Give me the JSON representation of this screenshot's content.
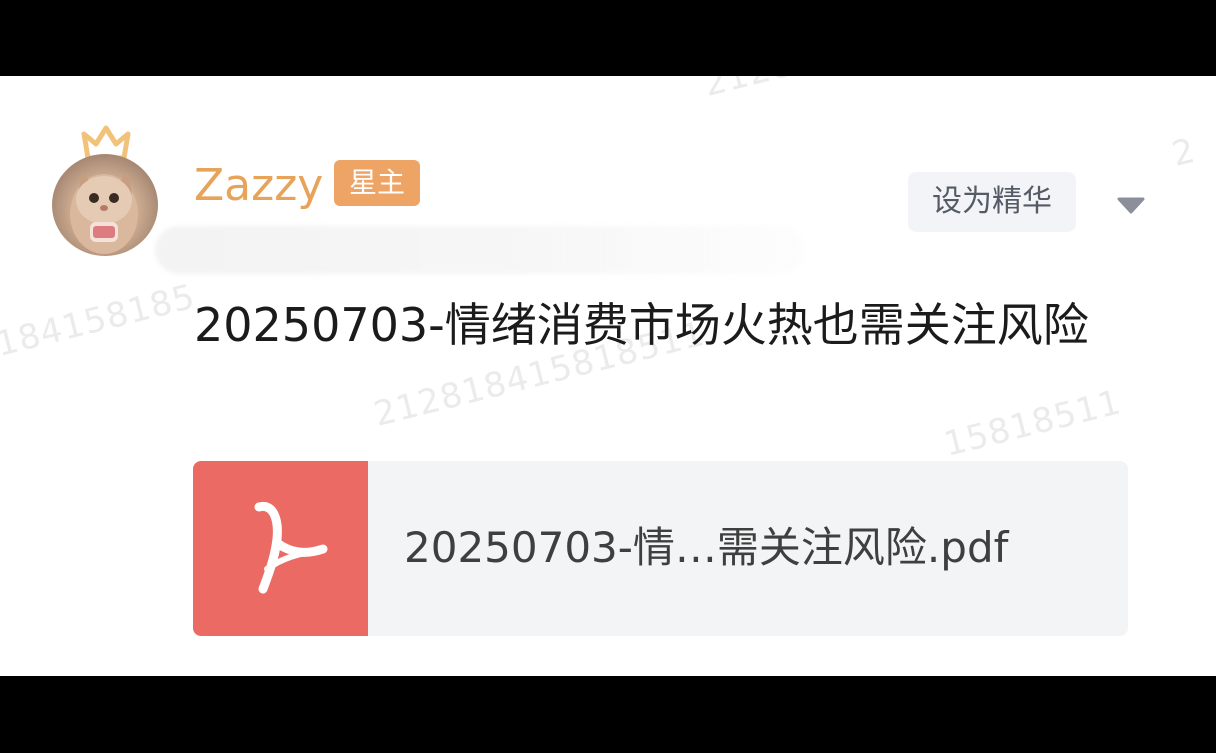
{
  "post": {
    "author": {
      "name": "Zazzy",
      "role_badge": "星主"
    },
    "actions": {
      "feature_label": "设为精华",
      "more_icon": "triangle-down-icon"
    },
    "title": "20250703-情绪消费市场火热也需关注风险",
    "attachment": {
      "file_name": "20250703-情…需关注风险.pdf",
      "icon": "pdf-icon",
      "icon_color": "#ec6a64"
    }
  },
  "watermark": {
    "text_a": "21281",
    "text_b": "184158185",
    "text_c": "2128184158185",
    "text_d": "212818415818511",
    "text_e": "2",
    "text_f": "15818511"
  },
  "colors": {
    "author_name": "#e8a35a",
    "role_badge_bg": "#eda464",
    "feature_button_bg": "#f2f4f7",
    "attachment_bg": "#f3f4f6"
  }
}
